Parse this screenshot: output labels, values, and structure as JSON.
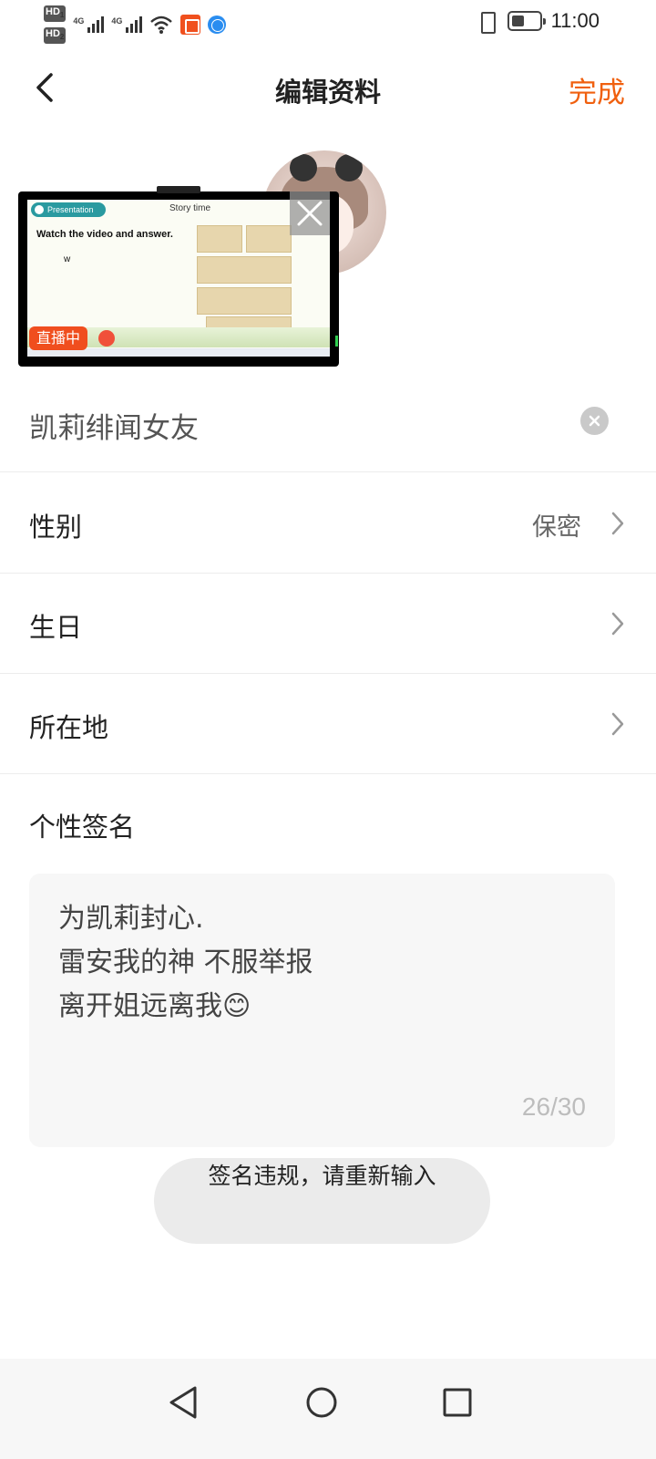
{
  "status_bar": {
    "hd1": "HD",
    "hd1_sub": "1",
    "hd2": "HD",
    "hd2_sub": "2",
    "net1": "4G",
    "net2": "4G",
    "battery_level": 0.45,
    "time": "11:00"
  },
  "header": {
    "title": "编辑资料",
    "done_label": "完成"
  },
  "video_overlay": {
    "pill_label": "Presentation",
    "story_label": "Story time",
    "instruction": "Watch the video and answer.",
    "letter": "w",
    "live_label": "直播中"
  },
  "profile": {
    "nickname": "凯莉绯闻女友"
  },
  "rows": {
    "gender_label": "性别",
    "gender_value": "保密",
    "birthday_label": "生日",
    "location_label": "所在地"
  },
  "signature": {
    "label": "个性签名",
    "line1": "为凯莉封心.",
    "line2": "雷安我的神 不服举报",
    "line3": "离开姐远离我😊",
    "counter": "26/30"
  },
  "toast": {
    "message": "签名违规，请重新输入"
  },
  "colors": {
    "accent": "#f0600f",
    "live_badge": "#f04e1e"
  },
  "icons": {
    "back": "chevron-left-icon",
    "close": "close-icon",
    "clear": "clear-circle-icon",
    "chevron": "chevron-right-icon",
    "nav_back": "triangle-back-icon",
    "nav_home": "circle-home-icon",
    "nav_recent": "square-recent-icon"
  }
}
